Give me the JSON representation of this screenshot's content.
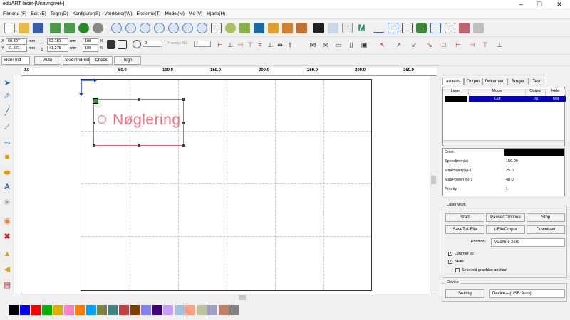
{
  "window": {
    "title": "eduART laser-[Unavngivet-]",
    "min": "–",
    "max": "☐",
    "close": "✕"
  },
  "menu": [
    "Filmenu (F)",
    "Edit (E)",
    "Tegn (D)",
    "Konfigurer(S)",
    "Værktøjer(W)",
    "Eksterne(T)",
    "Model(M)",
    "Vis (V)",
    "Hjælp(H)"
  ],
  "toolbar": {
    "x_label": "X",
    "y_label": "Y",
    "x_value": "60.307",
    "y_value": "41.321",
    "w_value": "92.181",
    "h_value": "41.275",
    "unit_mm": "mm",
    "pct_w": "100",
    "pct_h": "100",
    "pct_sign": "%",
    "angle_value": "0",
    "process_label": "Process No.",
    "process_value": "3"
  },
  "toolbar3": {
    "mode_select": "Skær Ind",
    "auto_label": "Auto",
    "process_select": "Skær Ind(Ud)",
    "check_label": "Check",
    "draw_label": "Tegn"
  },
  "ruler": {
    "ticks": [
      "0.0",
      "50.0",
      "100.0",
      "150.0",
      "200.0",
      "250.0",
      "300.0",
      "350.0"
    ]
  },
  "canvas": {
    "text": "Nøglering"
  },
  "panel": {
    "tabs": [
      "arbejds",
      "Output",
      "Dokument",
      "Bruger",
      "Test"
    ],
    "layer_headers": [
      "Layer",
      "Mode",
      "Output",
      "Hide"
    ],
    "layer_row": {
      "mode": "Cut",
      "output": "Ja",
      "hide": "Nej"
    },
    "props": [
      {
        "label": "Color",
        "value": ""
      },
      {
        "label": "Speed(mm/s)",
        "value": "150.00"
      },
      {
        "label": "MinPower(%)-1",
        "value": "25.0"
      },
      {
        "label": "MaxPower(%)-1",
        "value": "40.0"
      },
      {
        "label": "Priority",
        "value": "1"
      }
    ],
    "laserwork": {
      "title": "Laser work",
      "start": "Start",
      "pause": "Pause/Continue",
      "stop": "Stop",
      "save": "SaveToUFile",
      "ufile": "UFileOutput",
      "download": "Download",
      "position_label": "Position:",
      "position_value": "Machine zero",
      "opt1": "Optimer sti",
      "opt2": "Skær",
      "opt3": "Selected graphics position"
    },
    "device": {
      "title": "Device",
      "setting": "Setting",
      "device_value": "Device---(USB:Auto)"
    }
  },
  "colors": {
    "accent": "#0000ff",
    "engrave": "#f07080",
    "layer_selected": "#0000c8"
  },
  "palette": [
    "#000000",
    "#0000ff",
    "#ff0000",
    "#00b000",
    "#e0b000",
    "#ff80c0",
    "#ff8000",
    "#00a0ff",
    "#808040",
    "#408080",
    "#c04040",
    "#804000",
    "#8080ff",
    "#400080",
    "#c0a0ff",
    "#a0c0e0",
    "#ffa080",
    "#c0c0a0",
    "#a0a0c0",
    "#c08060",
    "#808080"
  ]
}
